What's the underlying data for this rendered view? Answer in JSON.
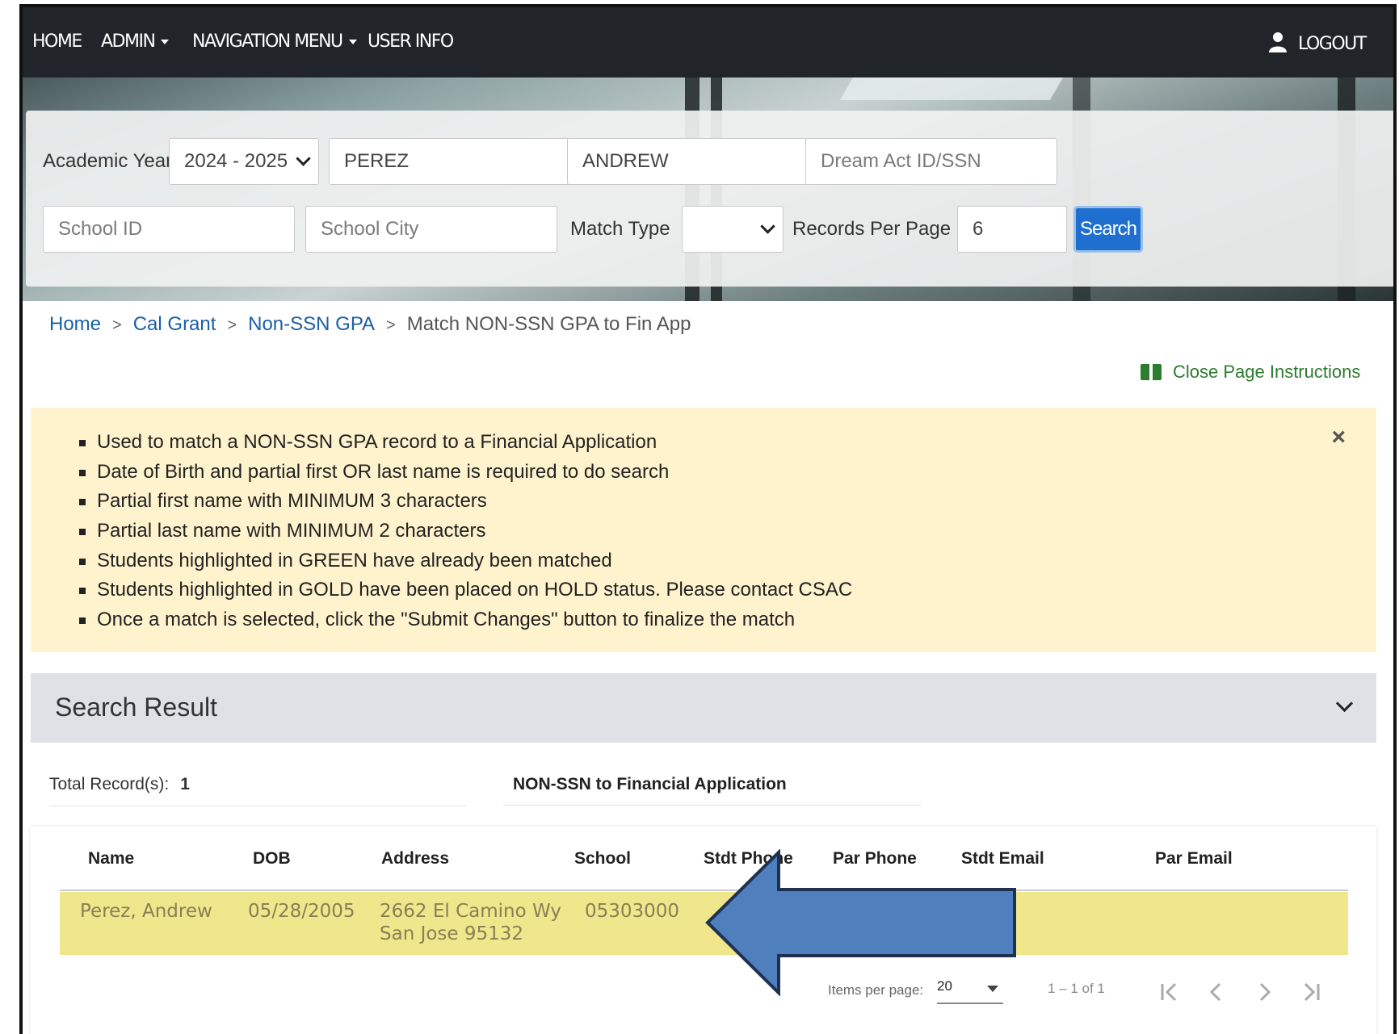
{
  "navbar": {
    "home": "HOME",
    "admin": "ADMIN",
    "navigation_menu": "NAVIGATION MENU",
    "user_info": "USER INFO",
    "logout": "LOGOUT"
  },
  "search": {
    "academic_year_label": "Academic Year",
    "academic_year_value": "2024 - 2025",
    "last_name_value": "PEREZ",
    "first_name_value": "ANDREW",
    "dream_act_placeholder": "Dream Act ID/SSN",
    "school_id_placeholder": "School ID",
    "school_city_placeholder": "School City",
    "match_type_label": "Match Type",
    "match_type_value": "",
    "records_per_page_label": "Records Per Page",
    "records_per_page_value": "6",
    "search_button": "Search"
  },
  "breadcrumb": {
    "items": [
      "Home",
      "Cal Grant",
      "Non-SSN GPA"
    ],
    "current": "Match NON-SSN GPA to Fin App",
    "separator": ">"
  },
  "close_instructions": "Close Page Instructions",
  "instructions": [
    "Used to match a NON-SSN GPA record to a Financial Application",
    "Date of Birth and partial first OR last name is required to do search",
    "Partial first name with MINIMUM 3 characters",
    "Partial last name with MINIMUM 2 characters",
    "Students highlighted in GREEN have already been matched",
    "Students highlighted in GOLD have been placed on HOLD status. Please contact CSAC",
    "Once a match is selected, click the \"Submit Changes\" button to finalize the match"
  ],
  "instructions_close": "×",
  "results": {
    "title": "Search Result",
    "total_label": "Total Record(s):",
    "total_value": "1",
    "table_title": "NON-SSN to Financial Application",
    "columns": [
      "Name",
      "DOB",
      "Address",
      "School",
      "Stdt Phone",
      "Par Phone",
      "Stdt Email",
      "Par Email"
    ],
    "rows": [
      {
        "name": "Perez, Andrew",
        "dob": "05/28/2005",
        "address_line1": "2662 El Camino Wy",
        "address_line2": "San Jose 95132",
        "school": "05303000",
        "stdt_phone": "",
        "par_phone": "",
        "stdt_email": "",
        "par_email": "",
        "highlight": "gold"
      }
    ]
  },
  "paginator": {
    "items_per_page_label": "Items per page:",
    "items_per_page_value": "20",
    "range": "1 – 1 of 1"
  },
  "colors": {
    "navbar": "#212529",
    "search_button": "#1f6fd1",
    "alert_bg": "#fff3cd",
    "gold_row": "#f0e68c",
    "annotation_arrow": "#4f7fbd",
    "link": "#1a5fa6",
    "instructions_link": "#2c7d2f"
  }
}
